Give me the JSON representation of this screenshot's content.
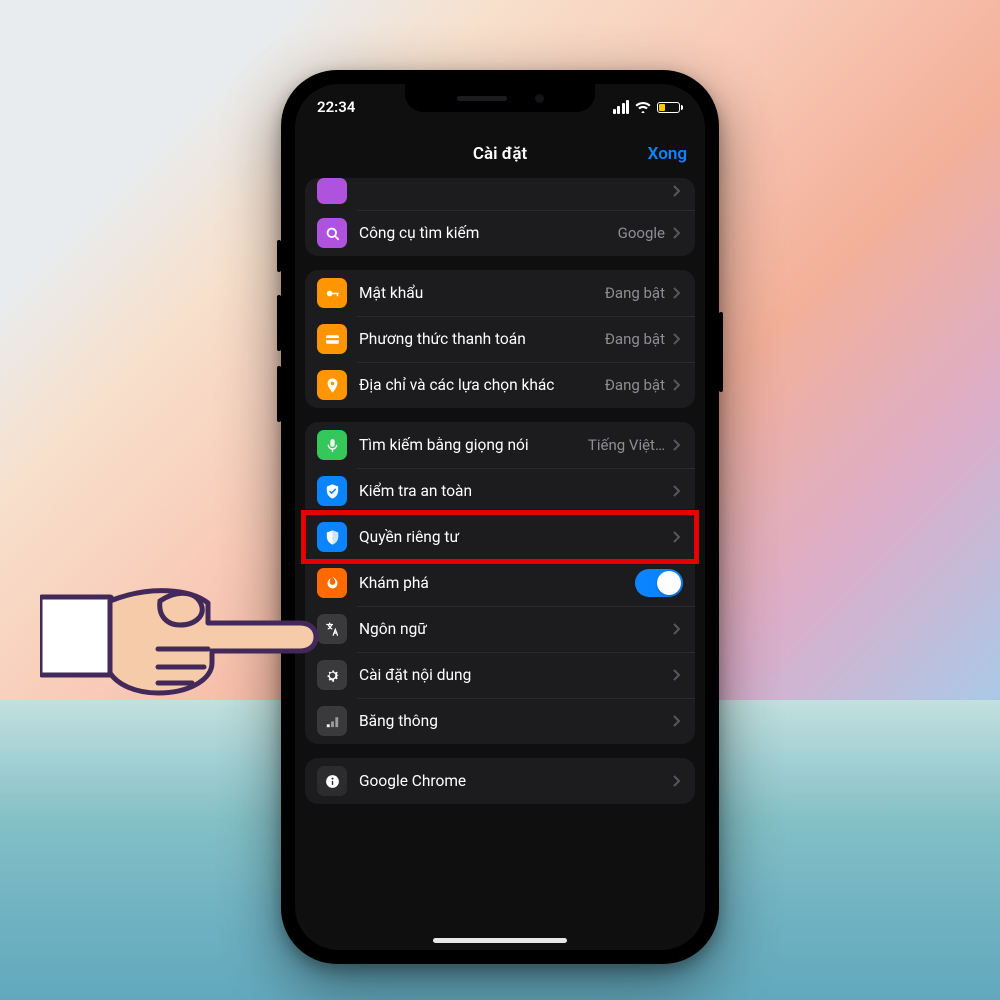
{
  "status": {
    "time": "22:34"
  },
  "nav": {
    "title": "Cài đặt",
    "done": "Xong"
  },
  "group0": {
    "search": {
      "label": "Công cụ tìm kiếm",
      "value": "Google"
    }
  },
  "group1": {
    "passwords": {
      "label": "Mật khẩu",
      "value": "Đang bật"
    },
    "payment": {
      "label": "Phương thức thanh toán",
      "value": "Đang bật"
    },
    "address": {
      "label": "Địa chỉ và các lựa chọn khác",
      "value": "Đang bật"
    }
  },
  "group2": {
    "voice": {
      "label": "Tìm kiếm bằng giọng nói",
      "value": "Tiếng Việt…"
    },
    "safety": {
      "label": "Kiểm tra an toàn"
    },
    "privacy": {
      "label": "Quyền riêng tư"
    },
    "explore": {
      "label": "Khám phá"
    },
    "language": {
      "label": "Ngôn ngữ"
    },
    "content": {
      "label": "Cài đặt nội dung"
    },
    "bandwidth": {
      "label": "Băng thông"
    }
  },
  "group3": {
    "chrome": {
      "label": "Google Chrome"
    }
  }
}
